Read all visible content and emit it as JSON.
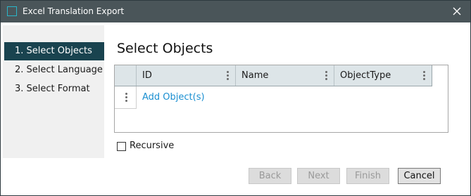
{
  "window": {
    "title": "Excel Translation Export",
    "icon": "window-outline-icon",
    "accent_color": "#29b6c9",
    "titlebar_color": "#4a5559"
  },
  "sidebar": {
    "active_color": "#19434f",
    "steps": [
      {
        "label": "1. Select Objects",
        "active": true
      },
      {
        "label": "2. Select Language",
        "active": false
      },
      {
        "label": "3. Select Format",
        "active": false
      }
    ]
  },
  "main": {
    "title": "Select Objects",
    "grid": {
      "columns": [
        "ID",
        "Name",
        "ObjectType"
      ],
      "add_row_label": "Add Object(s)",
      "link_color": "#1a8fd1"
    },
    "recursive": {
      "label": "Recursive",
      "checked": false
    }
  },
  "footer": {
    "buttons": [
      {
        "label": "Back",
        "enabled": false
      },
      {
        "label": "Next",
        "enabled": false
      },
      {
        "label": "Finish",
        "enabled": false
      },
      {
        "label": "Cancel",
        "enabled": true
      }
    ]
  }
}
